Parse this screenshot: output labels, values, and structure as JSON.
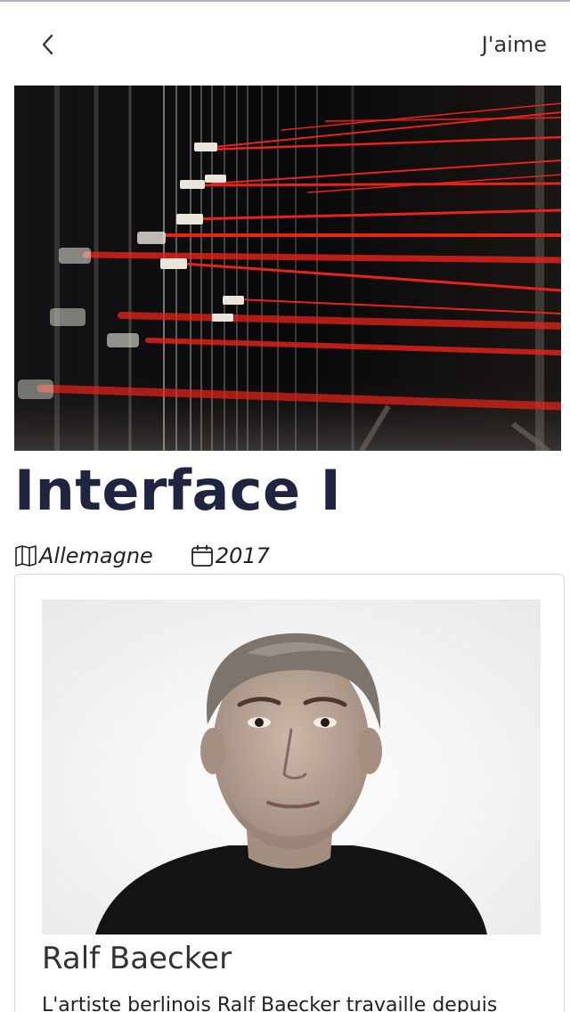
{
  "header": {
    "back_icon": "chevron-left-icon",
    "like_label": "J'aime"
  },
  "hero": {
    "description": "installation with red strings"
  },
  "artwork": {
    "title": "Interface I",
    "country": "Allemagne",
    "country_icon": "map-icon",
    "year": "2017",
    "year_icon": "calendar-icon"
  },
  "artist": {
    "name": "Ralf Baecker",
    "bio": "L'artiste berlinois Ralf Baecker travaille depuis"
  },
  "colors": {
    "title": "#1f2440",
    "accent_red": "#e8231a",
    "border": "#d8d8d8"
  }
}
